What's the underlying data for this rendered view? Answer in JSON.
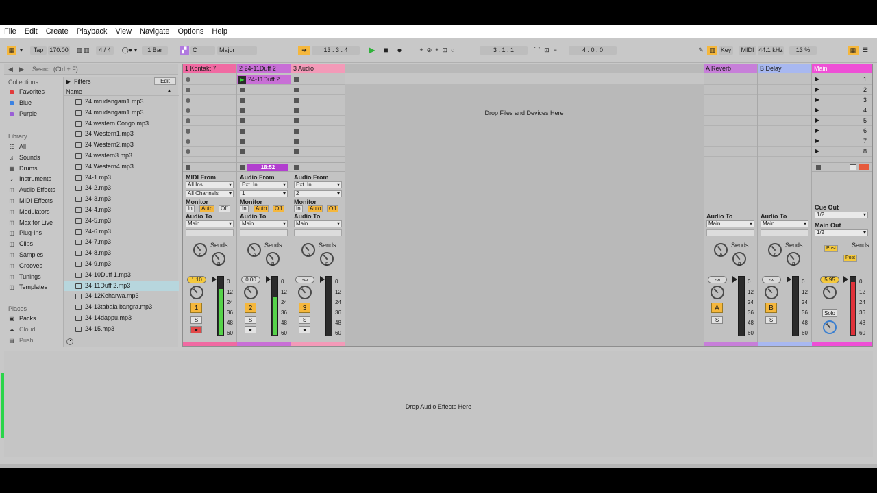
{
  "menu": [
    "File",
    "Edit",
    "Create",
    "Playback",
    "View",
    "Navigate",
    "Options",
    "Help"
  ],
  "control": {
    "tap": "Tap",
    "tempo": "170.00",
    "signature": "4 / 4",
    "quantize": "1 Bar",
    "key": "C",
    "scale": "Major",
    "arrangement_position": "13 .  3 .  4",
    "loop_start": "3 .  1 .  1",
    "loop_length": "4 .  0 .  0",
    "key_btn": "Key",
    "midi_btn": "MIDI",
    "sample_rate": "44.1 kHz",
    "cpu": "13 %"
  },
  "browser": {
    "search_placeholder": "Search (Ctrl + F)",
    "collections_header": "Collections",
    "collections": [
      {
        "label": "Favorites",
        "color": "#e23b3b"
      },
      {
        "label": "Blue",
        "color": "#3b82e2"
      },
      {
        "label": "Purple",
        "color": "#9a5fd6"
      }
    ],
    "library_header": "Library",
    "library": [
      {
        "label": "All",
        "icon": "list-icon"
      },
      {
        "label": "Sounds",
        "icon": "sounds-icon"
      },
      {
        "label": "Drums",
        "icon": "drums-icon"
      },
      {
        "label": "Instruments",
        "icon": "instruments-icon"
      },
      {
        "label": "Audio Effects",
        "icon": "audio-effects-icon"
      },
      {
        "label": "MIDI Effects",
        "icon": "midi-effects-icon"
      },
      {
        "label": "Modulators",
        "icon": "modulators-icon"
      },
      {
        "label": "Max for Live",
        "icon": "max-icon"
      },
      {
        "label": "Plug-Ins",
        "icon": "plugins-icon"
      },
      {
        "label": "Clips",
        "icon": "clips-icon"
      },
      {
        "label": "Samples",
        "icon": "samples-icon"
      },
      {
        "label": "Grooves",
        "icon": "grooves-icon"
      },
      {
        "label": "Tunings",
        "icon": "tunings-icon"
      },
      {
        "label": "Templates",
        "icon": "templates-icon"
      }
    ],
    "places_header": "Places",
    "places": [
      {
        "label": "Packs",
        "icon": "packs-icon"
      },
      {
        "label": "Cloud",
        "icon": "cloud-icon"
      },
      {
        "label": "Push",
        "icon": "push-icon"
      }
    ],
    "filters_label": "Filters",
    "edit_label": "Edit",
    "name_header": "Name",
    "files": [
      "24 mrudangam1.mp3",
      "24 mrudangam1.mp3",
      "24 western Congo.mp3",
      "24 Western1.mp3",
      "24 Western2.mp3",
      "24 western3.mp3",
      "24 Western4.mp3",
      "24-1.mp3",
      "24-2.mp3",
      "24-3.mp3",
      "24-4.mp3",
      "24-5.mp3",
      "24-6.mp3",
      "24-7.mp3",
      "24-8.mp3",
      "24-9.mp3",
      "24-10Duff 1.mp3",
      "24-11Duff 2.mp3",
      "24-12Keharwa.mp3",
      "24-13tabala bangra.mp3",
      "24-14dappu.mp3",
      "24-15.mp3"
    ],
    "selected_file_index": 17
  },
  "tracks": [
    {
      "name": "1 Kontakt 7",
      "color": "#f06aa2",
      "io_header": "MIDI From",
      "io_from": "All Ins",
      "io_sub": "All Channels",
      "monitor_header": "Monitor",
      "out_header": "Audio To",
      "out": "Main",
      "volume": "1.10",
      "number": "1",
      "solo": "S",
      "meter_level": 0.8,
      "meter_color": "#56d34a"
    },
    {
      "name": "2 24-11Duff 2",
      "color": "#c86fd6",
      "clip_name": "24-11Duff 2",
      "clip_time": "18:52",
      "io_header": "Audio From",
      "io_from": "Ext. In",
      "io_sub": "1",
      "monitor_header": "Monitor",
      "out_header": "Audio To",
      "out": "Main",
      "volume": "0.00",
      "number": "2",
      "solo": "S",
      "meter_level": 0.65,
      "meter_color": "#56d34a"
    },
    {
      "name": "3 Audio",
      "color": "#f39ab8",
      "io_header": "Audio From",
      "io_from": "Ext. In",
      "io_sub": "2",
      "monitor_header": "Monitor",
      "out_header": "Audio To",
      "out": "Main",
      "volume": "-∞",
      "number": "3",
      "solo": "S",
      "meter_level": 0,
      "meter_color": "#56d34a"
    }
  ],
  "monitor_buttons": [
    "In",
    "Auto",
    "Off"
  ],
  "sends_label": "Sends",
  "send_a": "A",
  "send_b": "B",
  "drop_files_text": "Drop Files and Devices Here",
  "returns": [
    {
      "name": "A Reverb",
      "color": "#c77fd9",
      "out_header": "Audio To",
      "out": "Main",
      "volume": "-∞",
      "letter": "A",
      "solo": "S"
    },
    {
      "name": "B Delay",
      "color": "#a8b8f0",
      "out_header": "Audio To",
      "out": "Main",
      "volume": "-∞",
      "letter": "B",
      "solo": "S"
    }
  ],
  "main": {
    "name": "Main",
    "color": "#ee4fd6",
    "scenes": [
      "1",
      "2",
      "3",
      "4",
      "5",
      "6",
      "7",
      "8"
    ],
    "cue_out_header": "Cue Out",
    "cue_out": "1/2",
    "main_out_header": "Main Out",
    "main_out": "1/2",
    "post": "Post",
    "volume": "5.95",
    "solo": "Solo",
    "meter_level": 0.92,
    "meter_color": "#e0323a"
  },
  "meter_scale": [
    "0",
    "12",
    "24",
    "36",
    "48",
    "60"
  ],
  "drop_effects_text": "Drop Audio Effects Here"
}
